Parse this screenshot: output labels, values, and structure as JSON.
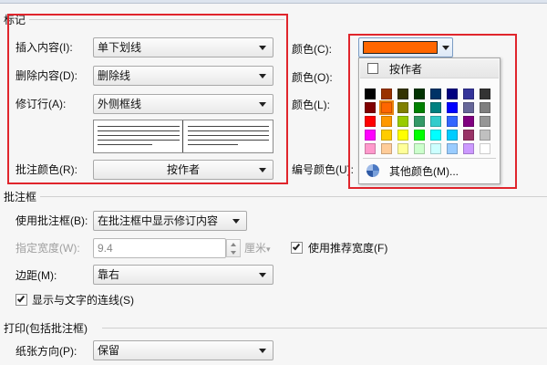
{
  "markup": {
    "section_title": "标记",
    "insert_label": "插入内容(I):",
    "insert_value": "单下划线",
    "delete_label": "删除内容(D):",
    "delete_value": "删除线",
    "revised_label": "修订行(A):",
    "revised_value": "外侧框线",
    "comment_color_label": "批注颜色(R):",
    "comment_color_value": "按作者",
    "color1_label": "颜色(C):",
    "color2_label": "颜色(O):",
    "color3_label": "颜色(L):",
    "number_color_label": "编号颜色(U):",
    "selected_color": "#ff6600"
  },
  "color_picker": {
    "auto_label": "按作者",
    "more_label": "其他颜色(M)...",
    "palette": [
      [
        "#000000",
        "#993300",
        "#333300",
        "#003300",
        "#003366",
        "#000080",
        "#333399",
        "#333333"
      ],
      [
        "#800000",
        "#ff6600",
        "#808000",
        "#008000",
        "#008080",
        "#0000ff",
        "#666699",
        "#808080"
      ],
      [
        "#ff0000",
        "#ff9900",
        "#99cc00",
        "#339966",
        "#33cccc",
        "#3366ff",
        "#800080",
        "#969696"
      ],
      [
        "#ff00ff",
        "#ffcc00",
        "#ffff00",
        "#00ff00",
        "#00ffff",
        "#00ccff",
        "#993366",
        "#c0c0c0"
      ],
      [
        "#ff99cc",
        "#ffcc99",
        "#ffff99",
        "#ccffcc",
        "#ccffff",
        "#99ccff",
        "#cc99ff",
        "#ffffff"
      ]
    ],
    "selected_row": 1,
    "selected_col": 1
  },
  "balloons": {
    "section_title": "批注框",
    "use_label": "使用批注框(B):",
    "use_value": "在批注框中显示修订内容",
    "width_label": "指定宽度(W):",
    "width_value": "9.4",
    "width_unit": "厘米",
    "recommended_width_label": "使用推荐宽度(F)",
    "recommended_width_checked": true,
    "margin_label": "边距(M):",
    "margin_value": "靠右",
    "show_lines_label": "显示与文字的连线(S)",
    "show_lines_checked": true
  },
  "printing": {
    "section_title": "打印(包括批注框)",
    "orientation_label": "纸张方向(P):",
    "orientation_value": "保留"
  }
}
